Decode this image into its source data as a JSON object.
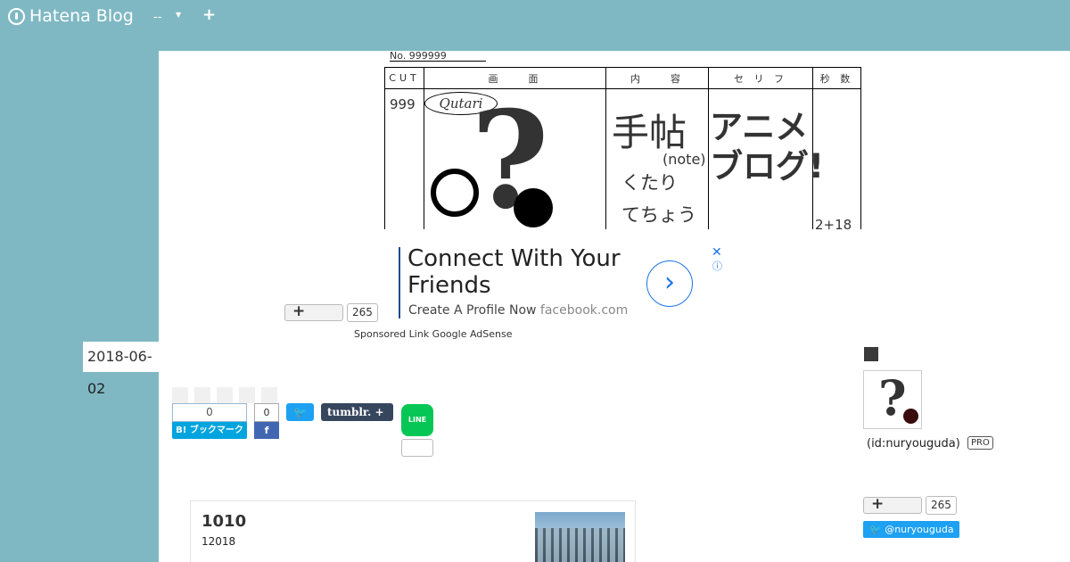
{
  "topbar": {
    "logo_text": "Hatena Blog",
    "blog_switch": "--",
    "add": "+"
  },
  "header_image": {
    "no_label": "No. 999999",
    "columns": [
      "CUT",
      "画　　面",
      "内　　容",
      "セ リ フ",
      "秒 数"
    ],
    "cut_number": "999",
    "logo_script": "Qutari",
    "glyph": "?",
    "kanji": "手帖",
    "note": "(note)",
    "kutari": "くたり",
    "techo": "てちょう",
    "anime_line1": "アニメ",
    "anime_line2": "ブログ!",
    "seconds": "2+18"
  },
  "ad": {
    "headline": "Connect With Your Friends",
    "sub": "Create A Profile Now",
    "domain": "facebook.com",
    "close": "✕",
    "info": "ⓘ",
    "arrow": "›"
  },
  "star_top": {
    "plus": "+",
    "count": "265"
  },
  "sponsored": "Sponsored Link Google AdSense",
  "date": {
    "line1": "2018-06-",
    "line2": "02"
  },
  "share": {
    "hatebu_count": "0",
    "hatebu_label": "B! ブックマーク",
    "fb_count": "0",
    "fb_label": "f",
    "tw_label": "🐦",
    "tumblr_label": "tumblr. +",
    "line_label": "LINE"
  },
  "related_card": {
    "title": "1010",
    "sub": "12018"
  },
  "sidebar": {
    "id": "(id:nuryouguda)",
    "pro": "PRO",
    "star_plus": "+",
    "star_count": "265",
    "twitter": "@nuryouguda"
  }
}
